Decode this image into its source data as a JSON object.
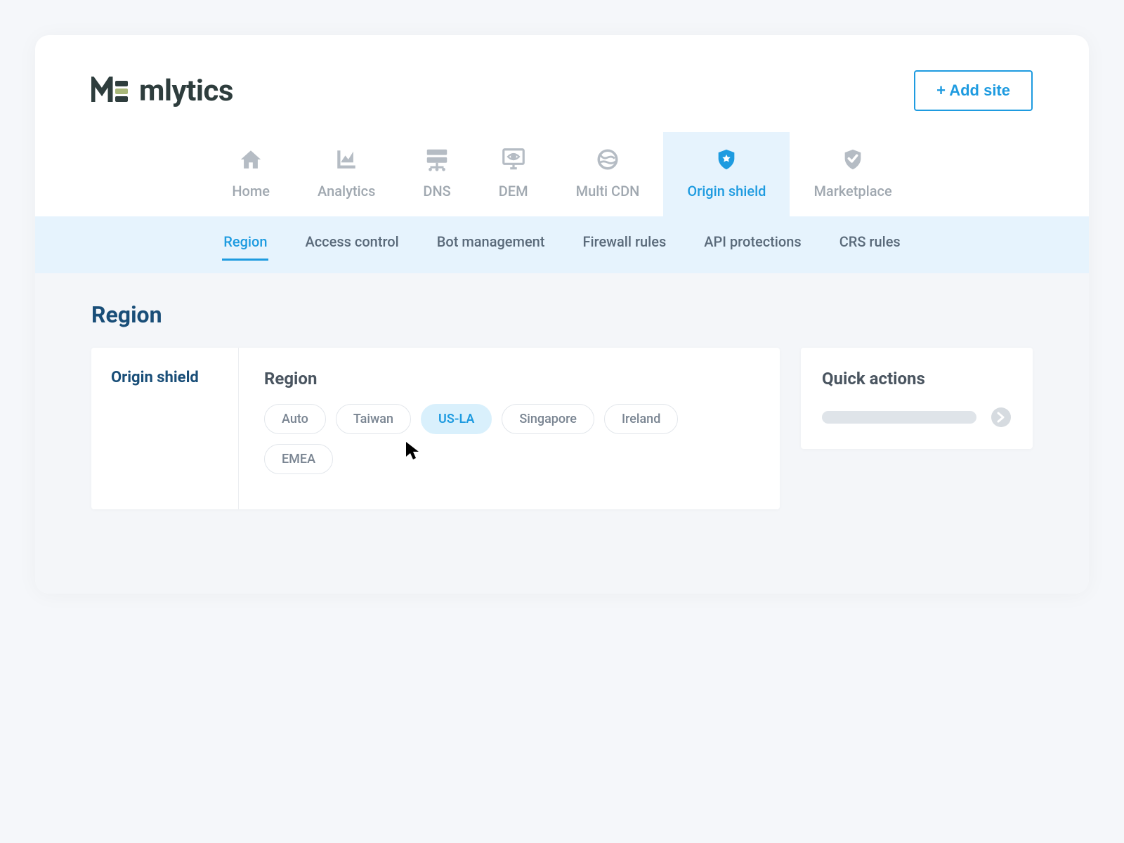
{
  "header": {
    "brand": "mlytics",
    "add_site_label": "+ Add site"
  },
  "nav_primary": [
    {
      "id": "home",
      "label": "Home",
      "icon": "home-icon"
    },
    {
      "id": "analytics",
      "label": "Analytics",
      "icon": "chart-icon"
    },
    {
      "id": "dns",
      "label": "DNS",
      "icon": "server-icon"
    },
    {
      "id": "dem",
      "label": "DEM",
      "icon": "monitor-eye-icon"
    },
    {
      "id": "multi-cdn",
      "label": "Multi CDN",
      "icon": "globe-icon"
    },
    {
      "id": "origin-shield",
      "label": "Origin shield",
      "icon": "shield-star-icon",
      "active": true
    },
    {
      "id": "marketplace",
      "label": "Marketplace",
      "icon": "shield-check-icon"
    }
  ],
  "nav_secondary": [
    {
      "id": "region",
      "label": "Region",
      "active": true
    },
    {
      "id": "access-control",
      "label": "Access control"
    },
    {
      "id": "bot-management",
      "label": "Bot management"
    },
    {
      "id": "firewall-rules",
      "label": "Firewall rules"
    },
    {
      "id": "api-protections",
      "label": "API protections"
    },
    {
      "id": "crs-rules",
      "label": "CRS rules"
    }
  ],
  "page": {
    "title": "Region"
  },
  "card": {
    "left_title": "Origin shield",
    "section_title": "Region",
    "regions": [
      {
        "id": "auto",
        "label": "Auto"
      },
      {
        "id": "taiwan",
        "label": "Taiwan"
      },
      {
        "id": "us-la",
        "label": "US-LA",
        "selected": true
      },
      {
        "id": "singapore",
        "label": "Singapore"
      },
      {
        "id": "ireland",
        "label": "Ireland"
      },
      {
        "id": "emea",
        "label": "EMEA"
      }
    ]
  },
  "quick_actions": {
    "title": "Quick actions"
  }
}
